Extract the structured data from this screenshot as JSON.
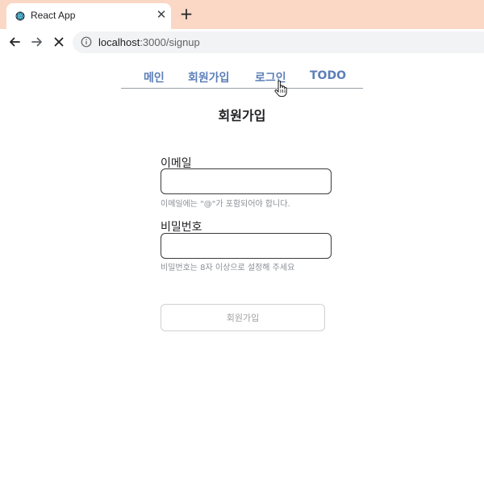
{
  "browser": {
    "tab_title": "React App",
    "url_host": "localhost",
    "url_path": ":3000/signup",
    "accent": "#fbd8c6"
  },
  "nav": {
    "items": [
      {
        "label": "메인"
      },
      {
        "label": "회원가입"
      },
      {
        "label": "로그인"
      },
      {
        "label": "TODO"
      }
    ],
    "link_color": "#5c7fb8"
  },
  "signup": {
    "title": "회원가입",
    "email_label": "이메일",
    "email_value": "",
    "email_hint": "이메일에는 \"@\"가 포함되어야 합니다.",
    "password_label": "비밀번호",
    "password_value": "",
    "password_hint": "비밀번호는 8자 이상으로 설정해 주세요",
    "submit_label": "회원가입"
  }
}
